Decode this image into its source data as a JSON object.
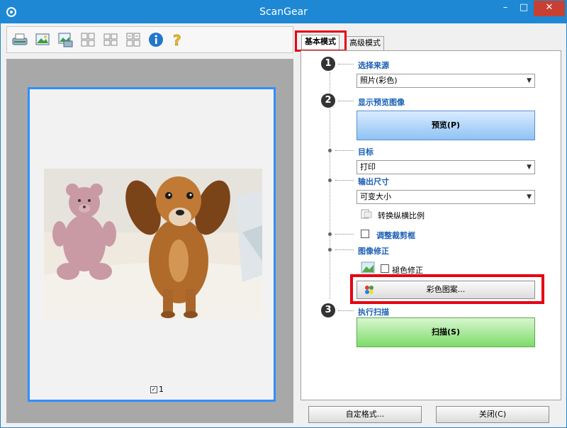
{
  "window": {
    "title": "ScanGear",
    "minimize_label": "–",
    "maximize_label": "□",
    "close_label": "✕"
  },
  "toolbar": {
    "icons": [
      "scanner-icon",
      "photo-icon",
      "photo-scan-icon",
      "grid-icon",
      "layout-icon",
      "thumbnails-icon",
      "info-icon",
      "help-icon"
    ]
  },
  "preview": {
    "checkbox_label": "1",
    "checkbox_checked": true
  },
  "tabs": {
    "basic": "基本模式",
    "advanced": "高级模式"
  },
  "steps": {
    "step1_num": "1",
    "step1_label": "选择来源",
    "source_value": "照片(彩色)",
    "step2_num": "2",
    "step2_label": "显示预览图像",
    "preview_button": "预览(P)",
    "destination_label": "目标",
    "destination_value": "打印",
    "output_size_label": "输出尺寸",
    "output_size_value": "可变大小",
    "aspect_label": "转换纵横比例",
    "crop_label": "调整裁剪框",
    "image_correction_label": "图像修正",
    "fade_correction_label": "褪色修正",
    "color_pattern_button": "彩色图案...",
    "step3_num": "3",
    "step3_label": "执行扫描",
    "scan_button": "扫描(S)"
  },
  "bottom": {
    "preferences_button": "自定格式...",
    "close_button": "关闭(C)"
  },
  "colors": {
    "title_bar": "#1e88d4",
    "highlight": "#e60012",
    "preview_button": "#90c2f4",
    "scan_button": "#7edb6a",
    "frame": "#2f8fff"
  }
}
